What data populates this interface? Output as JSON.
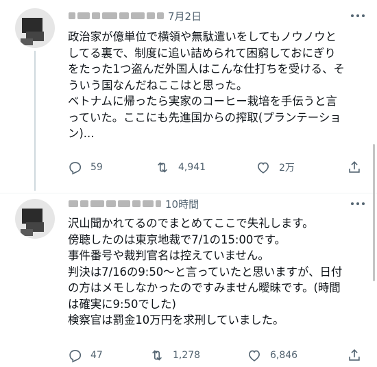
{
  "tweet1": {
    "time": "7月2日",
    "text": "政治家が億単位で横領や無駄遣いをしてもノウノウと\nしてる裏で、制度に追い詰められて困窮しておにぎり\nをたった1つ盗んだ外国人はこんな仕打ちを受ける、そ\nういう国なんだねここはと思った。\nベトナムに帰ったら実家のコーヒー栽培を手伝うと言\nっていた。ここにも先進国からの搾取(プランテーショ\nン)...",
    "replies": "59",
    "retweets": "4,941",
    "likes": "2万"
  },
  "tweet2": {
    "time": "10時間",
    "text": "沢山聞かれてるのでまとめてここで失礼します。\n傍聴したのは東京地裁で7/1の15:00です。\n事件番号や裁判官名は控えていません。\n判決は7/16の9:50〜と言っていたと思いますが、日付\nの方はメモしなかったのですみません曖昧です。(時間\nは確実に9:50でした)\n検察官は罰金10万円を求刑していました。",
    "replies": "47",
    "retweets": "1,278",
    "likes": "6,846"
  },
  "icons": [
    "reply-icon",
    "retweet-icon",
    "like-icon",
    "share-icon",
    "more-icon"
  ],
  "colors": {
    "icon": "#536471",
    "text": "#0f1419",
    "divider": "#eff3f4"
  }
}
